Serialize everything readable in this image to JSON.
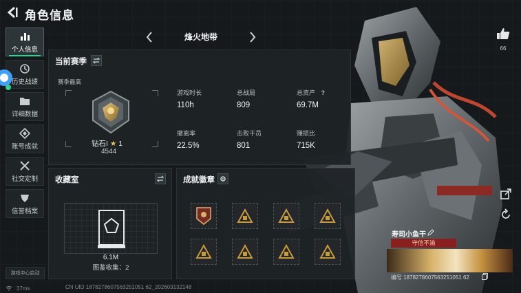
{
  "page": {
    "title": "角色信息"
  },
  "sidebar": {
    "items": [
      {
        "label": "个人信息",
        "icon": "bar-chart-icon",
        "active": true
      },
      {
        "label": "历史战绩",
        "icon": "history-icon",
        "active": false
      },
      {
        "label": "详细数据",
        "icon": "folder-icon",
        "active": false
      },
      {
        "label": "账号成就",
        "icon": "achievement-icon",
        "active": false
      },
      {
        "label": "社交定制",
        "icon": "tools-icon",
        "active": false
      },
      {
        "label": "信誉档案",
        "icon": "shield-icon",
        "active": false
      }
    ],
    "launch_center": "游戏中心启动"
  },
  "mode": {
    "name": "烽火地带"
  },
  "season": {
    "title": "当前赛季",
    "subtitle": "赛季最高",
    "rank_name": "钻石I",
    "rank_stars": "1",
    "rank_score": "4544",
    "stats": [
      {
        "label": "游戏时长",
        "value": "110h"
      },
      {
        "label": "总战局",
        "value": "809"
      },
      {
        "label": "总资产",
        "value": "69.7M",
        "help": "?"
      },
      {
        "label": "撤离率",
        "value": "22.5%"
      },
      {
        "label": "击败干员",
        "value": "801"
      },
      {
        "label": "赚损比",
        "value": "715K"
      }
    ]
  },
  "collection": {
    "title": "收藏室",
    "value": "6.1M",
    "count_text": "图鉴收集：2"
  },
  "achievements": {
    "title": "成就徽章",
    "slots": 8
  },
  "likes": {
    "count": "66"
  },
  "namecard": {
    "nickname": "寿司小鱼干",
    "title_badge": "守信不渝",
    "id_text": "编号 1878278607563251051 62"
  },
  "footer": {
    "latency": "37ms",
    "uid": "CN UID 1878278607563251051 62_202603132148"
  },
  "colors": {
    "accent": "#2fd38c",
    "title_badge": "#8a1f1f",
    "bg": "#15191c"
  }
}
